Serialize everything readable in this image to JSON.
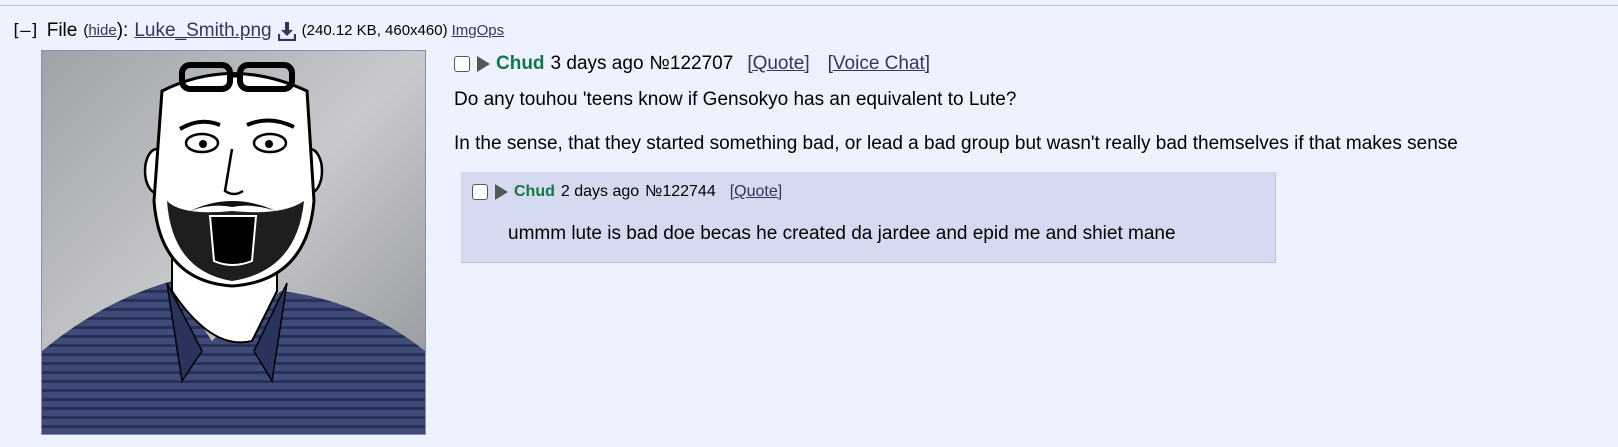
{
  "file": {
    "collapse": "[–]",
    "label": "File",
    "hide_open": "(",
    "hide_label": "hide",
    "hide_close": "):",
    "filename": "Luke_Smith.png",
    "meta": "(240.12 KB, 460x460)",
    "imgops": "ImgOps"
  },
  "op": {
    "name": "Chud",
    "time": "3 days ago",
    "postno": "№122707",
    "quote_label": "[Quote]",
    "voice_label": "[Voice Chat]",
    "paragraphs": [
      "Do any touhou 'teens know if Gensokyo has an equivalent to Lute?",
      "In the sense, that they started something bad, or lead a bad group but wasn't really bad themselves if that makes sense"
    ]
  },
  "reply": {
    "name": "Chud",
    "time": "2 days ago",
    "postno": "№122744",
    "quote_label": "[Quote]",
    "message": "ummm lute is bad doe becas he created da jardee and epid me and shiet mane"
  },
  "colors": {
    "background": "#eef2ff",
    "name_green": "#117743",
    "link": "#34345c",
    "reply_bg": "#d6daf0"
  },
  "icons": [
    "download-icon",
    "expand-triangle-icon",
    "checkbox"
  ]
}
